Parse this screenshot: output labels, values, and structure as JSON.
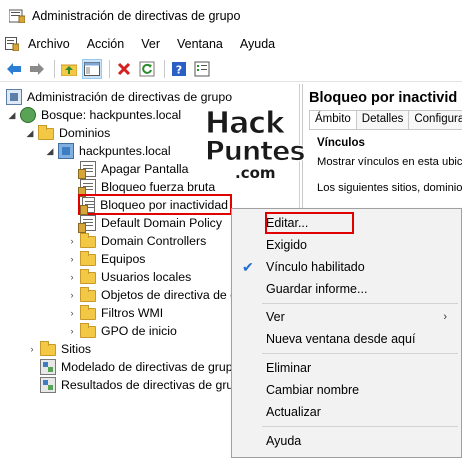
{
  "window": {
    "title": "Administración de directivas de grupo"
  },
  "menubar": {
    "items": [
      "Archivo",
      "Acción",
      "Ver",
      "Ventana",
      "Ayuda"
    ]
  },
  "toolbar": {
    "buttons": [
      "back-arrow-icon",
      "forward-arrow-icon",
      "folder-up-icon",
      "show-hide-tree-icon",
      "delete-icon",
      "refresh-icon",
      "help-icon",
      "properties-icon"
    ]
  },
  "tree": {
    "root": "Administración de directivas de grupo",
    "forest": "Bosque: hackpuntes.local",
    "domains": "Dominios",
    "domain": "hackpuntes.local",
    "gpos": [
      "Apagar Pantalla",
      "Bloqueo fuerza bruta",
      "Bloqueo por inactividad",
      "Default Domain Policy"
    ],
    "ous": [
      "Domain Controllers",
      "Equipos",
      "Usuarios locales",
      "Objetos de directiva de g",
      "Filtros WMI",
      "GPO de inicio"
    ],
    "sites": "Sitios",
    "modeling": "Modelado de directivas de grup",
    "results": "Resultados de directivas de gru"
  },
  "right_pane": {
    "header": "Bloqueo por inactivid",
    "tabs": [
      "Ámbito",
      "Detalles",
      "Configuraci"
    ],
    "section": "Vínculos",
    "text1": "Mostrar vínculos en esta ubica",
    "text2": "Los siguientes sitios, dominios y"
  },
  "context_menu": {
    "items": [
      {
        "label": "Editar...",
        "checked": false,
        "submenu": false
      },
      {
        "label": "Exigido",
        "checked": false,
        "submenu": false
      },
      {
        "label": "Vínculo habilitado",
        "checked": true,
        "submenu": false
      },
      {
        "label": "Guardar informe...",
        "checked": false,
        "submenu": false
      },
      {
        "label": "Ver",
        "checked": false,
        "submenu": true
      },
      {
        "label": "Nueva ventana desde aquí",
        "checked": false,
        "submenu": false
      },
      {
        "label": "Eliminar",
        "checked": false,
        "submenu": false
      },
      {
        "label": "Cambiar nombre",
        "checked": false,
        "submenu": false
      },
      {
        "label": "Actualizar",
        "checked": false,
        "submenu": false
      },
      {
        "label": "Ayuda",
        "checked": false,
        "submenu": false
      }
    ]
  },
  "watermark": {
    "line1": "Hack",
    "line2": "Puntes",
    "line3": ".com"
  },
  "colors": {
    "highlight_border": "#e00000",
    "check_color": "#1f6fd1",
    "active_tool_bg": "#cce4f7"
  }
}
